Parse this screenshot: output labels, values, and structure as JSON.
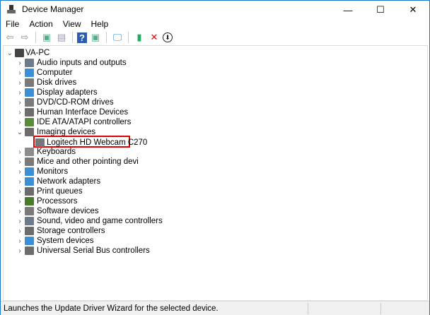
{
  "window": {
    "title": "Device Manager",
    "minimize": "—",
    "maximize": "☐",
    "close": "✕"
  },
  "menu": [
    "File",
    "Action",
    "View",
    "Help"
  ],
  "toolbar": [
    {
      "icon": "back-arrow-icon",
      "glyph": "⇦"
    },
    {
      "icon": "forward-arrow-icon",
      "glyph": "⇨"
    },
    {
      "icon": "properties-icon",
      "glyph": "▣"
    },
    {
      "icon": "show-hide-icon",
      "glyph": "▤"
    },
    {
      "icon": "help-icon",
      "glyph": "?"
    },
    {
      "icon": "action-pane-icon",
      "glyph": "▣"
    },
    {
      "icon": "scan-hardware-icon",
      "glyph": "🖵"
    },
    {
      "icon": "update-driver-icon",
      "glyph": "▮"
    },
    {
      "icon": "uninstall-icon",
      "glyph": "✕"
    },
    {
      "icon": "disable-icon",
      "glyph": "⬇"
    }
  ],
  "tree": {
    "root": "VA-PC",
    "items": [
      {
        "label": "Audio inputs and outputs",
        "color": "#6c7a89"
      },
      {
        "label": "Computer",
        "color": "#3a8fd6"
      },
      {
        "label": "Disk drives",
        "color": "#7a7a7a"
      },
      {
        "label": "Display adapters",
        "color": "#3a8fd6"
      },
      {
        "label": "DVD/CD-ROM drives",
        "color": "#7a7a7a"
      },
      {
        "label": "Human Interface Devices",
        "color": "#6c6c6c"
      },
      {
        "label": "IDE ATA/ATAPI controllers",
        "color": "#5a8a3a"
      },
      {
        "label": "Imaging devices",
        "color": "#6c6c6c",
        "expanded": true,
        "children": [
          "Logitech HD Webcam C270"
        ]
      },
      {
        "label": "Keyboards",
        "color": "#8c8c8c"
      },
      {
        "label": "Mice and other pointing devi",
        "color": "#7a7a7a"
      },
      {
        "label": "Monitors",
        "color": "#3a8fd6"
      },
      {
        "label": "Network adapters",
        "color": "#3a8fd6"
      },
      {
        "label": "Print queues",
        "color": "#6c6c6c"
      },
      {
        "label": "Processors",
        "color": "#4a7a2a"
      },
      {
        "label": "Software devices",
        "color": "#7a7a7a"
      },
      {
        "label": "Sound, video and game controllers",
        "color": "#6c7a89"
      },
      {
        "label": "Storage controllers",
        "color": "#6c6c6c"
      },
      {
        "label": "System devices",
        "color": "#3a8fd6"
      },
      {
        "label": "Universal Serial Bus controllers",
        "color": "#6c6c6c"
      }
    ]
  },
  "status": "Launches the Update Driver Wizard for the selected device."
}
